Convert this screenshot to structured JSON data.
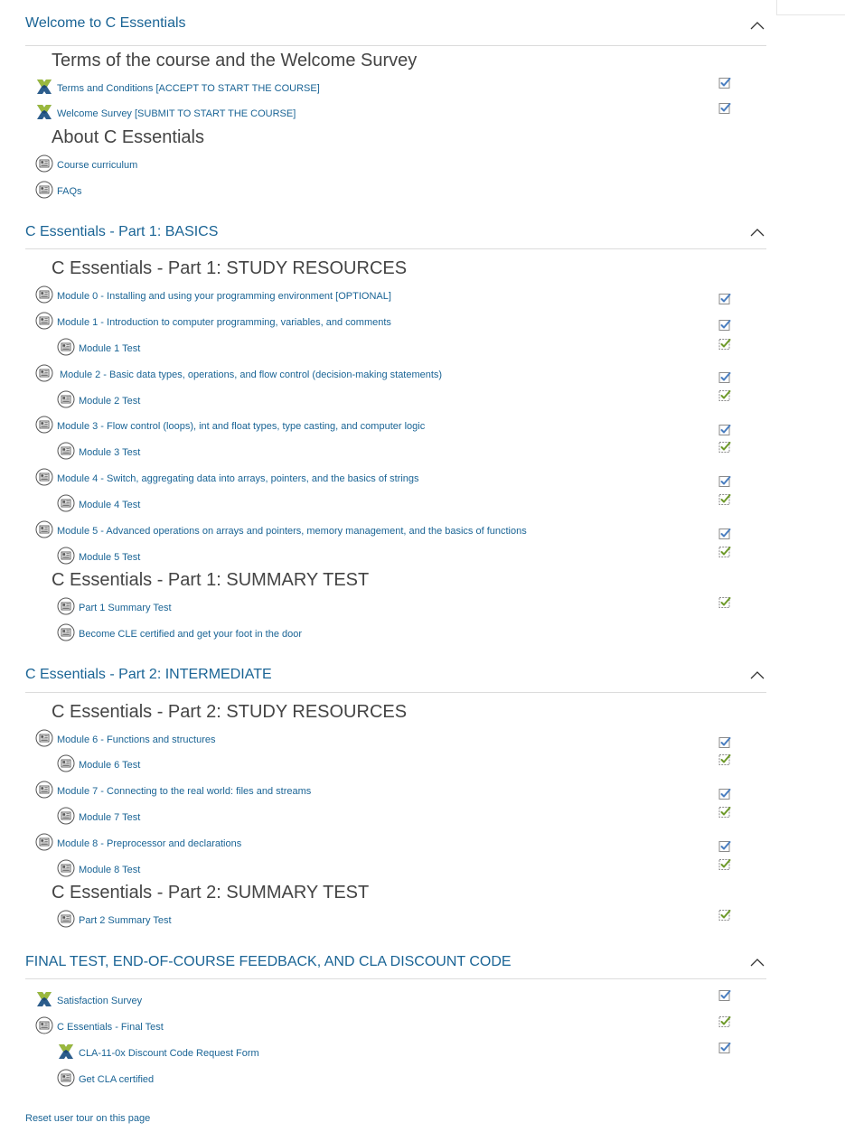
{
  "sections": [
    {
      "title": "Welcome to C Essentials",
      "subheadings": [
        "Terms of the course and the Welcome Survey",
        "About C Essentials"
      ],
      "items": [
        {
          "label": "Terms and Conditions [ACCEPT TO START THE COURSE]",
          "icon": "feedback-icon",
          "check": "manual-done"
        },
        {
          "label": "Welcome Survey [SUBMIT TO START THE COURSE]",
          "icon": "feedback-icon",
          "check": "manual-done"
        },
        {
          "label": "Course curriculum",
          "icon": "page-icon",
          "check": null
        },
        {
          "label": "FAQs",
          "icon": "page-icon",
          "check": null
        }
      ]
    },
    {
      "title": "C Essentials - Part 1: BASICS",
      "subheadings": [
        "C Essentials - Part 1: STUDY RESOURCES",
        "C Essentials - Part 1: SUMMARY TEST"
      ],
      "items": [
        {
          "label": "Module 0 - Installing and using your programming environment [OPTIONAL]",
          "icon": "page-icon",
          "check": "manual-done"
        },
        {
          "label": "Module 1 - Introduction to computer programming, variables, and comments",
          "icon": "page-icon",
          "check": "manual-done"
        },
        {
          "label": "Module 1 Test",
          "icon": "page-icon",
          "check": "auto-pass"
        },
        {
          "label": "Module 2 - Basic data types, operations, and flow control (decision-making statements)",
          "icon": "page-icon",
          "check": "manual-done"
        },
        {
          "label": "Module 2 Test",
          "icon": "page-icon",
          "check": "auto-pass"
        },
        {
          "label": "Module 3 - Flow control (loops), int and float types, type casting, and computer logic",
          "icon": "page-icon",
          "check": "manual-done"
        },
        {
          "label": "Module 3 Test",
          "icon": "page-icon",
          "check": "auto-pass"
        },
        {
          "label": "Module 4 - Switch, aggregating data into arrays, pointers, and the basics of strings",
          "icon": "page-icon",
          "check": "manual-done"
        },
        {
          "label": "Module 4 Test",
          "icon": "page-icon",
          "check": "auto-pass"
        },
        {
          "label": "Module 5 - Advanced operations on arrays and pointers, memory management, and the basics of functions",
          "icon": "page-icon",
          "check": "manual-done"
        },
        {
          "label": "Module 5 Test",
          "icon": "page-icon",
          "check": "auto-pass"
        },
        {
          "label": "Part 1 Summary Test",
          "icon": "page-icon",
          "check": "auto-pass"
        },
        {
          "label": "Become CLE certified and get your foot in the door",
          "icon": "page-icon",
          "check": null
        }
      ]
    },
    {
      "title": "C Essentials - Part 2: INTERMEDIATE",
      "subheadings": [
        "C Essentials - Part 2: STUDY RESOURCES",
        "C Essentials - Part 2: SUMMARY TEST"
      ],
      "items": [
        {
          "label": "Module 6 - Functions and structures",
          "icon": "page-icon",
          "check": "manual-done"
        },
        {
          "label": "Module 6 Test",
          "icon": "page-icon",
          "check": "auto-pass"
        },
        {
          "label": "Module 7 - Connecting to the real world: files and streams",
          "icon": "page-icon",
          "check": "manual-done"
        },
        {
          "label": "Module 7 Test",
          "icon": "page-icon",
          "check": "auto-pass"
        },
        {
          "label": "Module 8 - Preprocessor and declarations",
          "icon": "page-icon",
          "check": "manual-done"
        },
        {
          "label": "Module 8 Test",
          "icon": "page-icon",
          "check": "auto-pass"
        },
        {
          "label": "Part 2 Summary Test",
          "icon": "page-icon",
          "check": "auto-pass"
        }
      ]
    },
    {
      "title": "FINAL TEST, END-OF-COURSE FEEDBACK, AND CLA DISCOUNT CODE",
      "subheadings": [],
      "items": [
        {
          "label": "Satisfaction Survey",
          "icon": "feedback-icon",
          "check": "manual-done"
        },
        {
          "label": "C Essentials - Final Test",
          "icon": "page-icon",
          "check": "auto-pass"
        },
        {
          "label": "CLA-11-0x Discount Code Request Form",
          "icon": "feedback-icon",
          "check": "manual-done"
        },
        {
          "label": "Get CLA certified",
          "icon": "page-icon",
          "check": null
        }
      ]
    }
  ],
  "footer": {
    "reset_tour": "Reset user tour on this page"
  },
  "colors": {
    "link": "#1a6495",
    "heading": "#444444",
    "check_blue": "#4a7ec0",
    "check_green": "#6e9a2a"
  }
}
